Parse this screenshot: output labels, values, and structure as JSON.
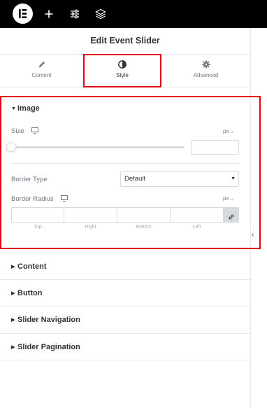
{
  "topbar": {
    "logo_icon": "elementor-logo-icon",
    "add_icon": "plus-icon",
    "settings_icon": "sliders-icon",
    "layers_icon": "layers-icon"
  },
  "header": {
    "title": "Edit Event Slider"
  },
  "tabs": [
    {
      "label": "Content",
      "icon": "pencil-icon"
    },
    {
      "label": "Style",
      "icon": "half-circle-icon",
      "active": true
    },
    {
      "label": "Advanced",
      "icon": "gear-icon"
    }
  ],
  "image_section": {
    "title": "Image",
    "size": {
      "label": "Size",
      "unit": "px",
      "value": ""
    },
    "border_type": {
      "label": "Border Type",
      "selected": "Default"
    },
    "border_radius": {
      "label": "Border Radius",
      "unit": "px",
      "fields": [
        "Top",
        "Right",
        "Bottom",
        "Left"
      ]
    }
  },
  "sections": [
    {
      "title": "Content"
    },
    {
      "title": "Button"
    },
    {
      "title": "Slider Navigation"
    },
    {
      "title": "Slider Pagination"
    }
  ],
  "colors": {
    "accent_highlight": "#e0001a",
    "topbar_bg": "#000000"
  }
}
